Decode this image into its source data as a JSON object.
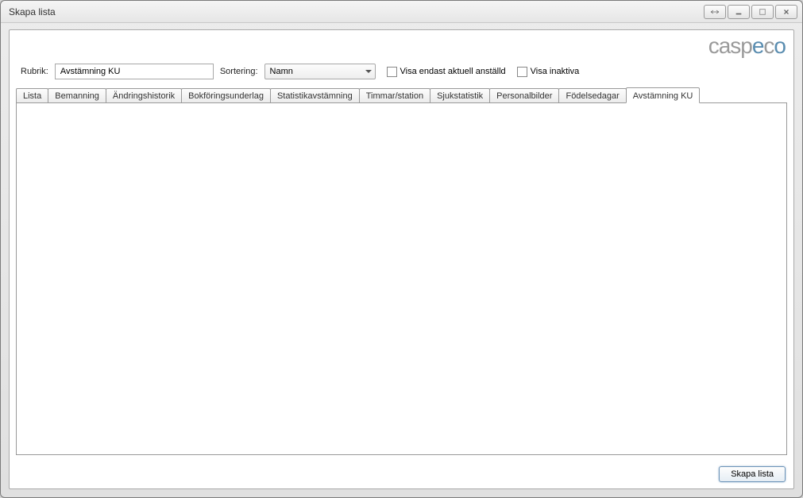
{
  "window": {
    "title": "Skapa lista"
  },
  "logo": {
    "text_parts": [
      "casp",
      "e",
      "c",
      "o"
    ]
  },
  "form": {
    "rubrik_label": "Rubrik:",
    "rubrik_value": "Avstämning KU",
    "sortering_label": "Sortering:",
    "sortering_value": "Namn",
    "checkbox1_label": "Visa endast aktuell anställd",
    "checkbox2_label": "Visa inaktiva"
  },
  "tabs": [
    {
      "label": "Lista",
      "active": false
    },
    {
      "label": "Bemanning",
      "active": false
    },
    {
      "label": "Ändringshistorik",
      "active": false
    },
    {
      "label": "Bokföringsunderlag",
      "active": false
    },
    {
      "label": "Statistikavstämning",
      "active": false
    },
    {
      "label": "Timmar/station",
      "active": false
    },
    {
      "label": "Sjukstatistik",
      "active": false
    },
    {
      "label": "Personalbilder",
      "active": false
    },
    {
      "label": "Födelsedagar",
      "active": false
    },
    {
      "label": "Avstämning KU",
      "active": true
    }
  ],
  "footer": {
    "create_button": "Skapa lista"
  }
}
